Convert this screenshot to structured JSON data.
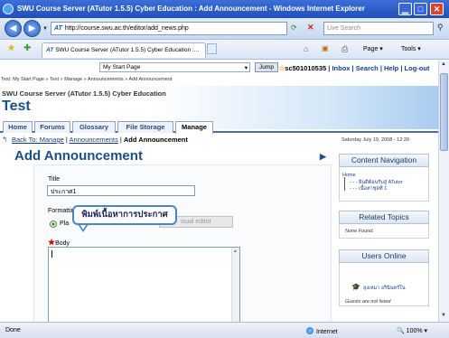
{
  "window": {
    "title": "SWU Course Server (ATutor 1.5.5) Cyber Education : Add Announcement - Windows Internet Explorer",
    "minimize_glyph": "▁",
    "maximize_glyph": "□",
    "close_glyph": "✕"
  },
  "browser": {
    "address": "http://course.swu.ac.th/editor/add_news.php",
    "search_placeholder": "Live Search",
    "tab_title": "SWU Course Server (ATutor 1.5.5) Cyber Education :...",
    "page_menu": "Page",
    "tools_menu": "Tools",
    "status": "Done",
    "zone": "Internet",
    "zoom": "100%"
  },
  "topbar": {
    "jump_select": "My Start Page",
    "jump_button": "Jump",
    "user": "sc501010535",
    "links": "| Inbox | Search | Help | Log-out"
  },
  "breadcrumb_top": "Test: My Start Page » Test » Manage » Announcements » Add Announcement",
  "course": {
    "server_title": "SWU Course Server (ATutor 1.5.5) Cyber Education",
    "name": "Test"
  },
  "nav_tabs": [
    "Home",
    "Forums",
    "Glossary",
    "File Storage",
    "Manage"
  ],
  "breadcrumb": {
    "back": "Back To: Manage",
    "sep": "|",
    "announcements": "Announcements",
    "current": "Add Announcement"
  },
  "date": "Saturday July 19, 2008 - 12:39",
  "page_title": "Add Announcement",
  "form": {
    "title_label": "Title",
    "title_value": "ประกาศ1",
    "formatting_label": "Formatting",
    "plain_label": "Pla",
    "visual_editor_label": "isual editor",
    "body_required": "★",
    "body_label": "Body"
  },
  "tooltip": "พิมพ์เนื้อหาการประกาศ",
  "sidebar": {
    "content_nav_title": "Content Navigation",
    "nav_home": "Home",
    "nav_items": [
      "ยินดีต้อนรับสู่ ATutor",
      "เนื้อหาชุดที่ 1"
    ],
    "related_title": "Related Topics",
    "related_none": "None Found.",
    "users_online_title": "Users Online",
    "online_user": "ลุงเหมา อรินินทร์ใน",
    "guests_note": "Guests are not listed"
  },
  "colors": {
    "accent": "#1b4f8a",
    "titlebar": "#2a5cc8",
    "tooltip_border": "#4e83c9"
  }
}
